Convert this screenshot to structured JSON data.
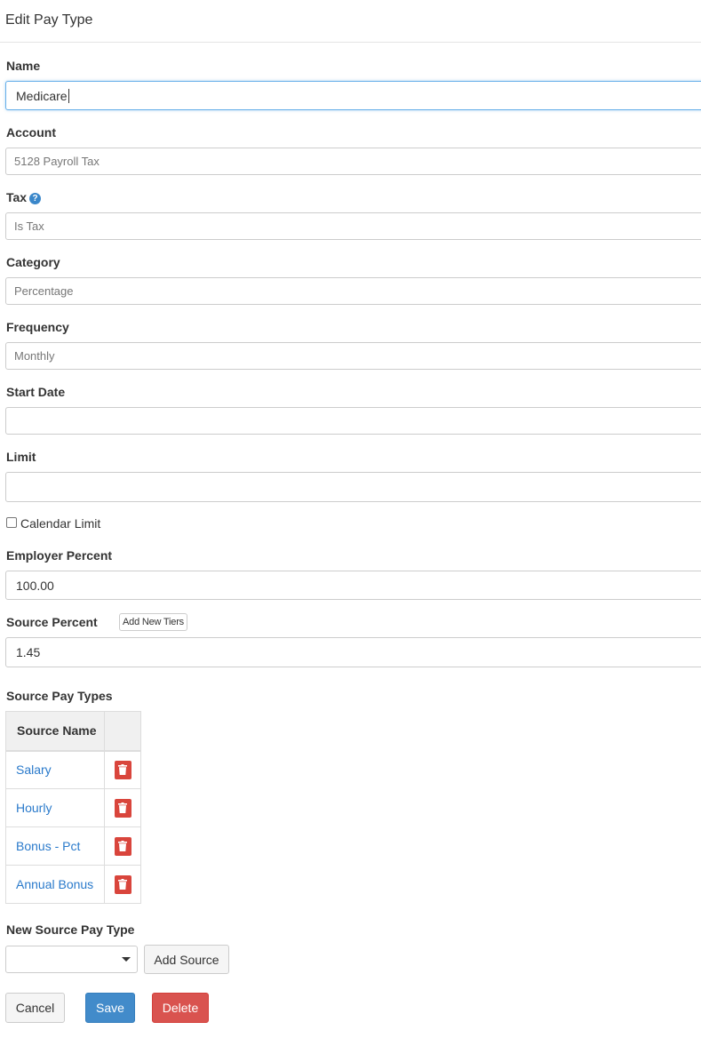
{
  "header": {
    "title": "Edit Pay Type"
  },
  "form": {
    "name": {
      "label": "Name",
      "value": "Medicare"
    },
    "account": {
      "label": "Account",
      "value": "5128 Payroll Tax"
    },
    "tax": {
      "label": "Tax",
      "help_glyph": "?",
      "value": "Is Tax"
    },
    "category": {
      "label": "Category",
      "value": "Percentage"
    },
    "frequency": {
      "label": "Frequency",
      "value": "Monthly"
    },
    "start_date": {
      "label": "Start Date",
      "value": ""
    },
    "limit": {
      "label": "Limit",
      "value": ""
    },
    "calendar_limit": {
      "label": "Calendar Limit",
      "checked": false
    },
    "employer_percent": {
      "label": "Employer Percent",
      "value": "100.00"
    },
    "source_percent": {
      "label": "Source Percent",
      "add_tiers_label": "Add New Tiers",
      "value": "1.45"
    }
  },
  "source_pay_types": {
    "heading": "Source Pay Types",
    "columns": [
      "Source Name",
      ""
    ],
    "rows": [
      {
        "name": "Salary"
      },
      {
        "name": "Hourly"
      },
      {
        "name": "Bonus - Pct"
      },
      {
        "name": "Annual Bonus"
      }
    ]
  },
  "new_source": {
    "label": "New Source Pay Type",
    "selected": "",
    "add_label": "Add Source"
  },
  "actions": {
    "cancel": "Cancel",
    "save": "Save",
    "delete": "Delete"
  },
  "colors": {
    "primary": "#428bca",
    "danger": "#d9534f",
    "link": "#2a7acb",
    "help": "#3a87ca"
  },
  "icons": {
    "help": "help-icon",
    "delete": "trash-icon",
    "dropdown": "chevron-down-icon"
  }
}
